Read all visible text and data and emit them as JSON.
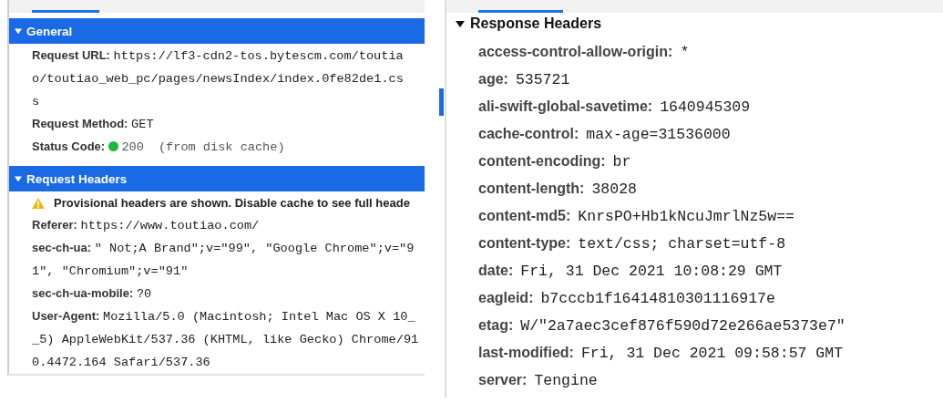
{
  "left_panel": {
    "sections": [
      {
        "title": "General",
        "expanded": true,
        "selected": true,
        "rows": [
          {
            "kind": "pair",
            "label": "Request URL:",
            "value": "https://lf3-cdn2-tos.bytescm.com/toutia\no/toutiao_web_pc/pages/newsIndex/index.0fe82de1.cs\ns"
          },
          {
            "kind": "pair",
            "label": "Request Method:",
            "value": "GET"
          },
          {
            "kind": "status",
            "label": "Status Code:",
            "value": "200",
            "note": "(from disk cache)",
            "color": "#1db83a"
          }
        ]
      },
      {
        "title": "Request Headers",
        "expanded": true,
        "selected": true,
        "rows": [
          {
            "kind": "warning",
            "value": "Provisional headers are shown. Disable cache to see full heade"
          },
          {
            "kind": "pair",
            "label": "Referer:",
            "value": "https://www.toutiao.com/"
          },
          {
            "kind": "pair",
            "label": "sec-ch-ua:",
            "value": "\" Not;A Brand\";v=\"99\", \"Google Chrome\";v=\"9\n1\", \"Chromium\";v=\"91\""
          },
          {
            "kind": "pair",
            "label": "sec-ch-ua-mobile:",
            "value": "?0"
          },
          {
            "kind": "pair",
            "label": "User-Agent:",
            "value": "Mozilla/5.0 (Macintosh; Intel Mac OS X 10_\n_5) AppleWebKit/537.36 (KHTML, like Gecko) Chrome/91\n0.4472.164 Safari/537.36"
          }
        ]
      }
    ]
  },
  "right_panel": {
    "section": {
      "title": "Response Headers",
      "expanded": true,
      "selected": false,
      "rows": [
        {
          "label": "access-control-allow-origin:",
          "value": "*"
        },
        {
          "label": "age:",
          "value": "535721"
        },
        {
          "label": "ali-swift-global-savetime:",
          "value": "1640945309"
        },
        {
          "label": "cache-control:",
          "value": "max-age=31536000"
        },
        {
          "label": "content-encoding:",
          "value": "br"
        },
        {
          "label": "content-length:",
          "value": "38028"
        },
        {
          "label": "content-md5:",
          "value": "KnrsPO+Hb1kNcuJmrlNz5w=="
        },
        {
          "label": "content-type:",
          "value": "text/css; charset=utf-8"
        },
        {
          "label": "date:",
          "value": "Fri, 31 Dec 2021 10:08:29 GMT"
        },
        {
          "label": "eagleid:",
          "value": "b7cccb1f16414810301116917e"
        },
        {
          "label": "etag:",
          "value": "W/\"2a7aec3cef876f590d72e266ae5373e7\""
        },
        {
          "label": "last-modified:",
          "value": "Fri, 31 Dec 2021 09:58:57 GMT"
        },
        {
          "label": "server:",
          "value": "Tengine"
        }
      ]
    }
  }
}
